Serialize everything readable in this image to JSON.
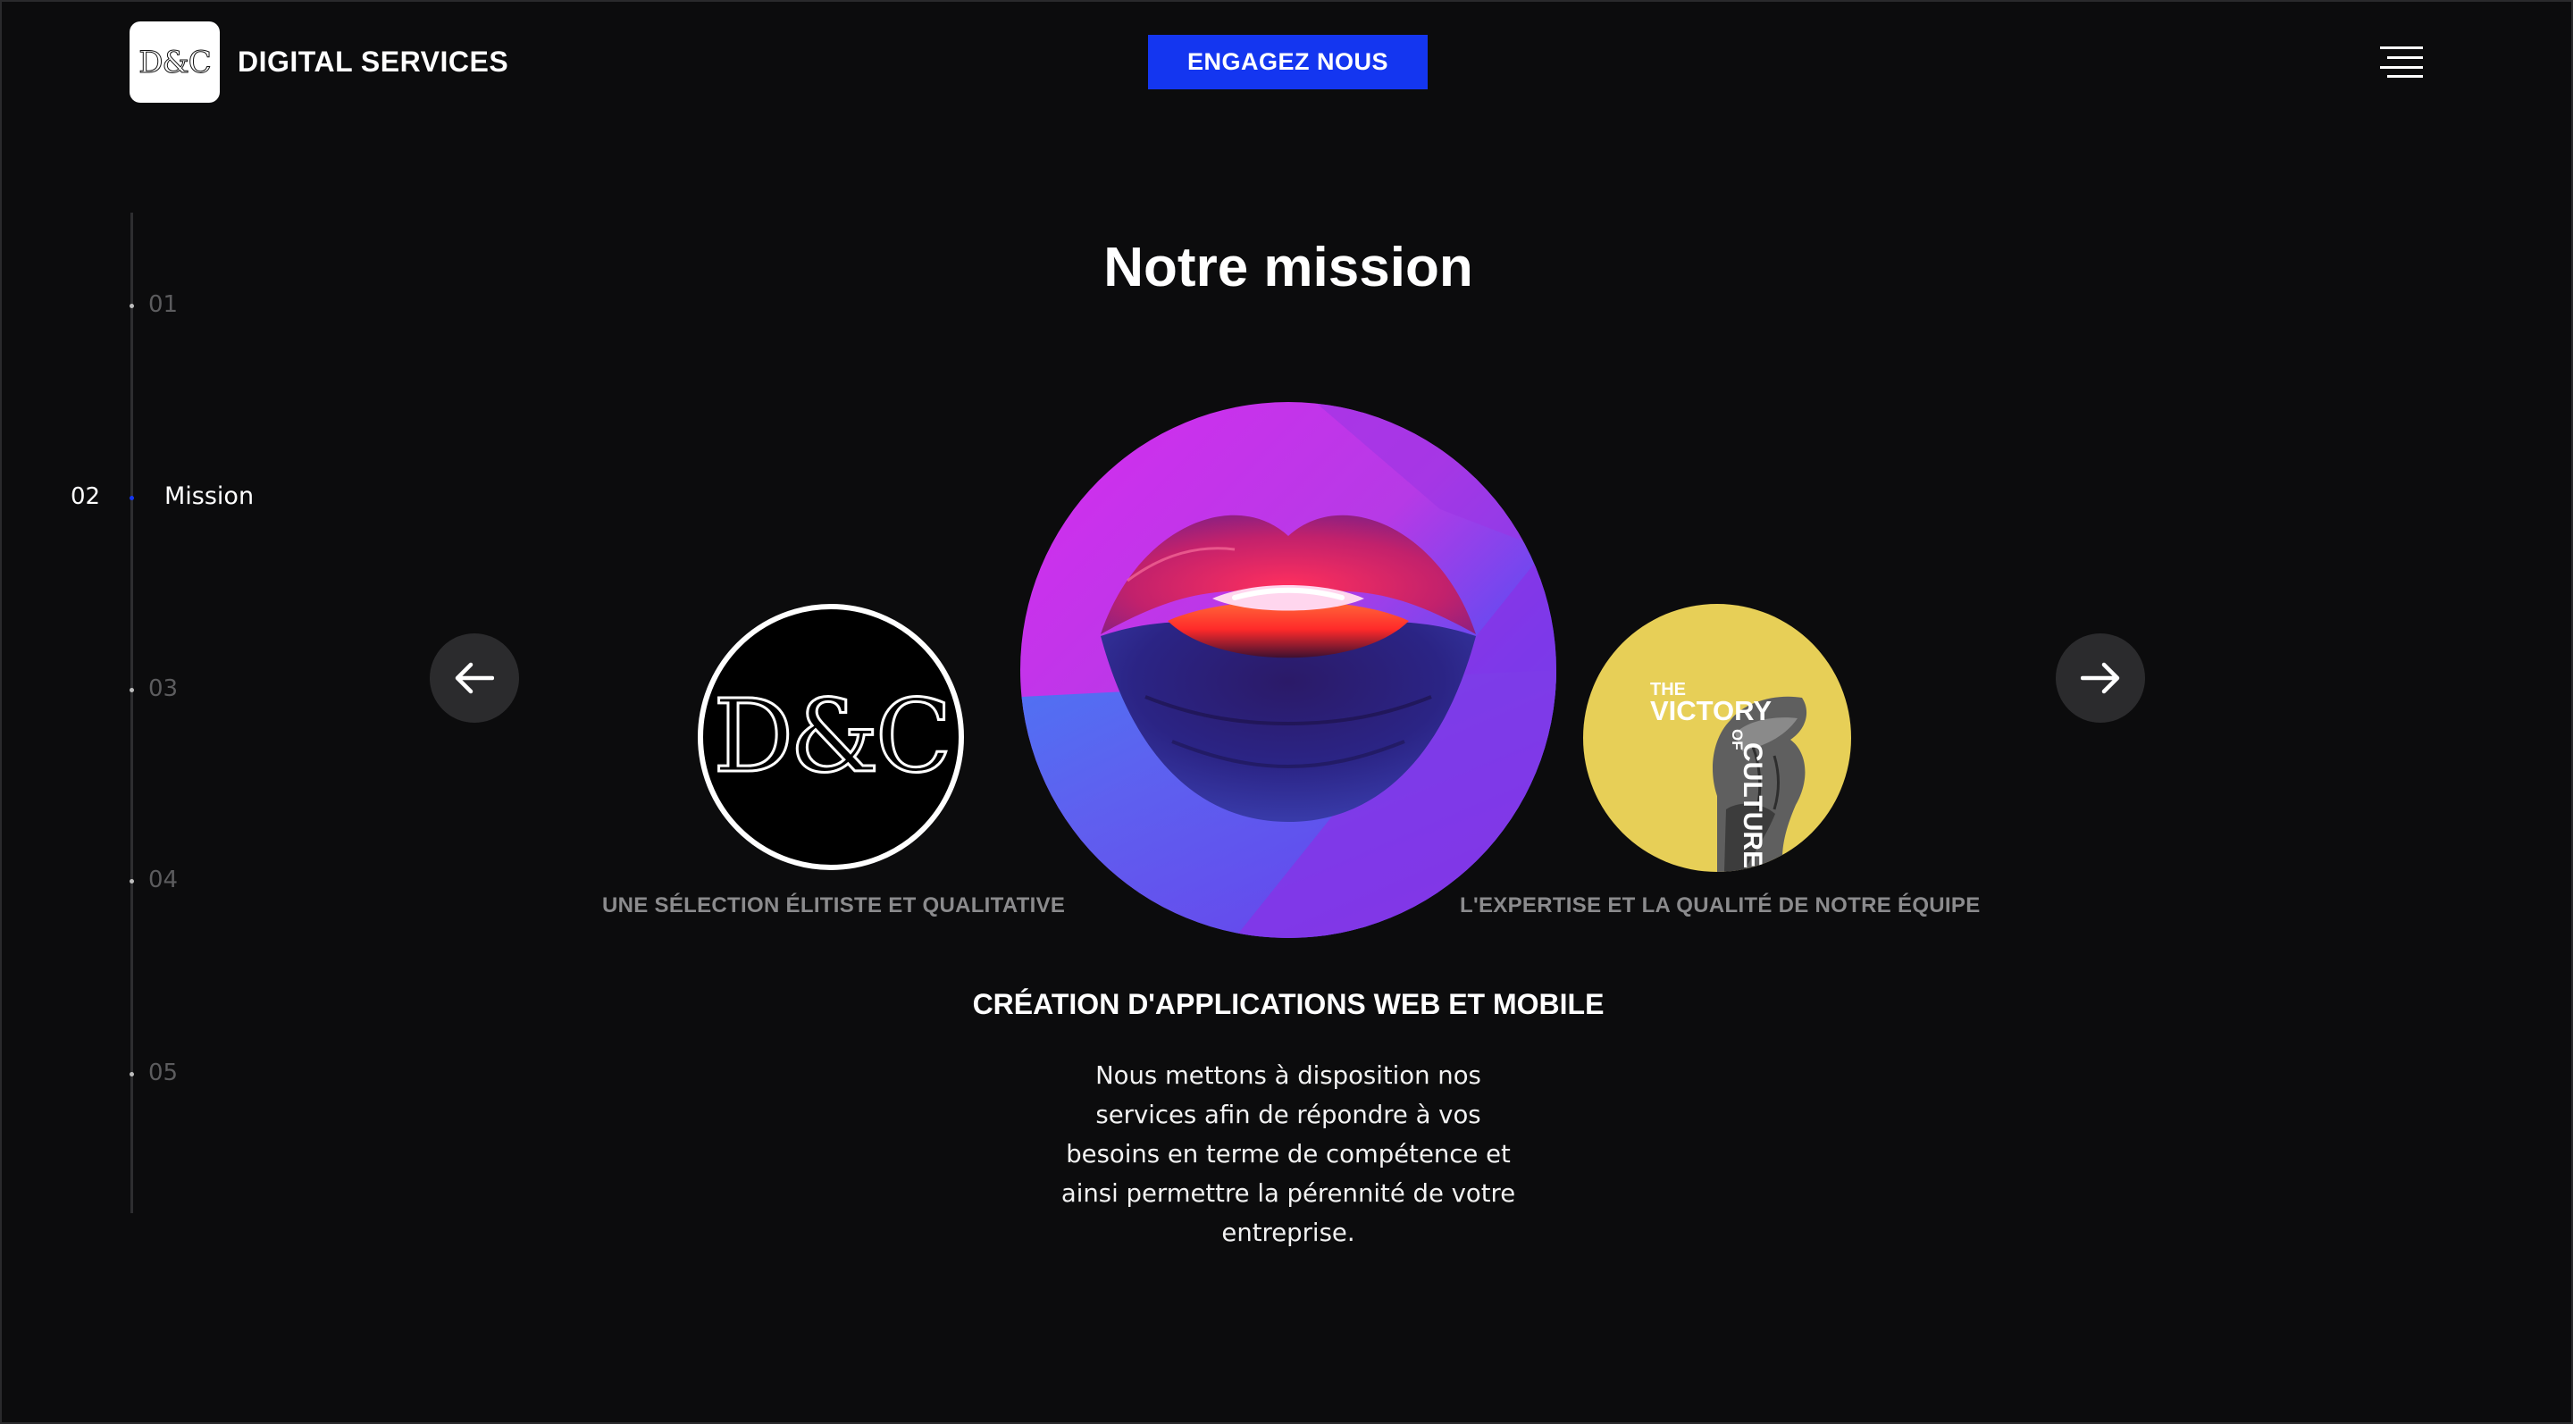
{
  "header": {
    "logo_text": "D&C",
    "brand_name": "DIGITAL SERVICES",
    "cta_label": "ENGAGEZ NOUS",
    "menu_icon": "hamburger-menu-icon"
  },
  "side_nav": {
    "items": [
      {
        "number": "01",
        "label": ""
      },
      {
        "number": "02",
        "label": "Mission",
        "active": true
      },
      {
        "number": "03",
        "label": ""
      },
      {
        "number": "04",
        "label": ""
      },
      {
        "number": "05",
        "label": ""
      }
    ]
  },
  "main": {
    "title": "Notre mission",
    "carousel": {
      "prev_icon": "arrow-left-icon",
      "next_icon": "arrow-right-icon",
      "slides": [
        {
          "caption": "UNE SÉLECTION ÉLITISTE ET QUALITATIVE",
          "image": "dc-logo",
          "logo_text": "D&C"
        },
        {
          "caption": "CRÉATION D'APPLICATIONS WEB ET MOBILE",
          "image": "lips-neon",
          "active": true
        },
        {
          "caption": "L'EXPERTISE ET LA QUALITÉ DE NOTRE ÉQUIPE",
          "image": "victory-of-culture",
          "image_text": [
            "THE",
            "VICTORY",
            "OF",
            "CULTURE"
          ]
        }
      ]
    },
    "description": "Nous mettons à disposition nos services afin de répondre à vos besoins en terme de compétence et ainsi permettre la pérennité de votre entreprise."
  },
  "colors": {
    "background": "#0c0c0d",
    "accent": "#1436f0",
    "caption_gray": "#8b8b8d",
    "victory_yellow": "#e7cf57"
  }
}
